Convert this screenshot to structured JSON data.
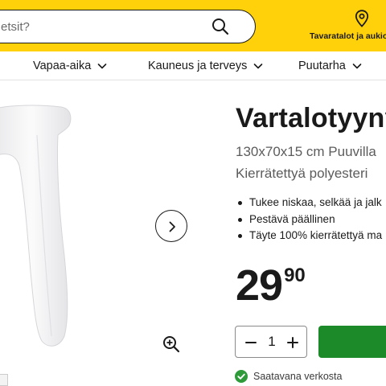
{
  "header": {
    "search_placeholder": "etsit?",
    "store_locator_label": "Tavaratalot ja aukio"
  },
  "nav": {
    "items": [
      {
        "label": "Vapaa-aika"
      },
      {
        "label": "Kauneus ja terveys"
      },
      {
        "label": "Puutarha"
      }
    ]
  },
  "product": {
    "title": "Vartalotyyny",
    "subtitle_line1": "130x70x15 cm Puuvilla",
    "subtitle_line2": "Kierrätettyä polyesteri",
    "features": [
      "Tukee niskaa, selkää ja jalk",
      "Pestävä päällinen",
      "Täyte 100% kierrätettyä ma"
    ],
    "price_int": "29",
    "price_dec": "90",
    "quantity": "1",
    "availability": "Saatavana verkosta"
  },
  "colors": {
    "header_bg": "#ffd10a",
    "cta_green": "#1d8a2a",
    "available_green": "#2e9a3a"
  },
  "icons": [
    "search-icon",
    "location-pin-icon",
    "chevron-down-icon",
    "chevron-right-icon",
    "zoom-in-icon",
    "minus-icon",
    "plus-icon",
    "check-circle-icon"
  ]
}
